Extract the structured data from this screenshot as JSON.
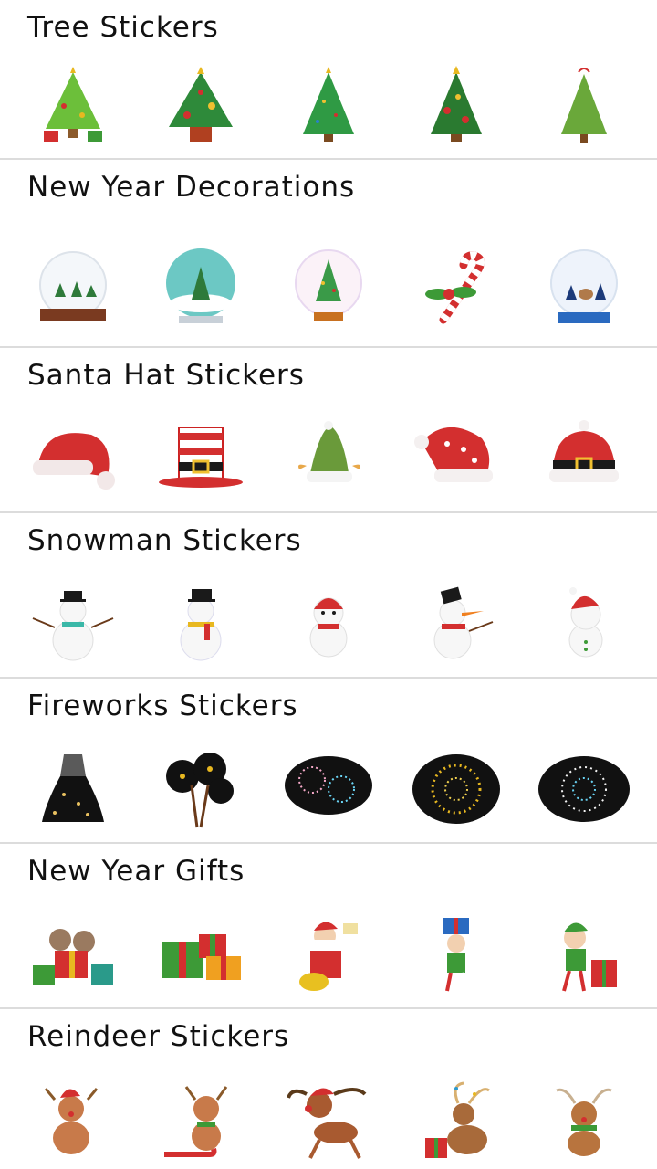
{
  "sections": [
    {
      "title": "Tree Stickers",
      "stickers": [
        "christmas-tree-with-gifts",
        "decorated-tree-in-pot",
        "tree-with-string-lights",
        "tree-with-ornaments",
        "simple-green-tree"
      ]
    },
    {
      "title": "New Year Decorations",
      "stickers": [
        "snow-globe-with-sleigh",
        "snow-globe-with-tree",
        "snow-globe-sparkling-tree",
        "candy-cane-with-holly",
        "snow-globe-with-reindeer"
      ]
    },
    {
      "title": "Santa Hat Stickers",
      "stickers": [
        "santa-hat-red",
        "striped-top-hat",
        "green-elf-hat",
        "santa-hat-polka-dot",
        "santa-hat-with-belt"
      ]
    },
    {
      "title": "Snowman Stickers",
      "stickers": [
        "snowman-with-scarf",
        "snowman-top-hat",
        "snowman-red-hat",
        "snowman-with-carrot",
        "snowman-santa-hat"
      ]
    },
    {
      "title": "Fireworks Stickers",
      "stickers": [
        "firework-rocket",
        "sparkler-bouquet",
        "fireworks-colorful",
        "firework-golden-burst",
        "firework-sparkle-burst"
      ]
    },
    {
      "title": "New Year Gifts",
      "stickers": [
        "sloths-with-gifts",
        "stack-of-gift-boxes",
        "santa-with-gift-bag",
        "elf-holding-gift",
        "elf-with-present"
      ]
    },
    {
      "title": "Reindeer Stickers",
      "stickers": [
        "reindeer-santa-hat",
        "reindeer-with-sled",
        "reindeer-running",
        "reindeer-with-lights",
        "reindeer-with-scarf"
      ]
    }
  ],
  "colors": {
    "divider": "#dcdcdc",
    "christmas_red": "#d32f2f",
    "christmas_green": "#3d9a37",
    "gold": "#e8b820"
  }
}
